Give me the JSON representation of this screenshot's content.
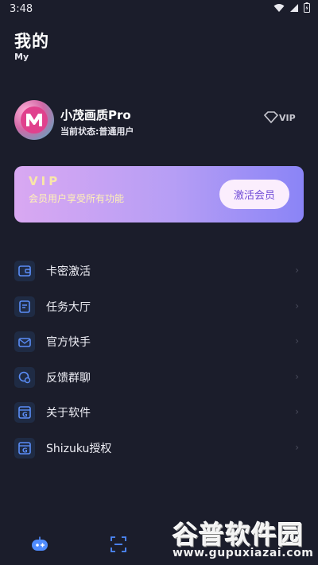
{
  "status_bar": {
    "time": "3:48"
  },
  "header": {
    "title": "我的",
    "subtitle": "My"
  },
  "profile": {
    "name": "小茂画质Pro",
    "status": "当前状态:普通用户",
    "badge_label": "VIP"
  },
  "vip_card": {
    "title": "VIP",
    "description": "会员用户享受所有功能",
    "button_label": "激活会员"
  },
  "menu": {
    "items": [
      {
        "label": "卡密激活",
        "icon": "wallet-icon"
      },
      {
        "label": "任务大厅",
        "icon": "edit-icon"
      },
      {
        "label": "官方快手",
        "icon": "mail-icon"
      },
      {
        "label": "反馈群聊",
        "icon": "chat-icon"
      },
      {
        "label": "关于软件",
        "icon": "g-app-icon"
      },
      {
        "label": "Shizuku授权",
        "icon": "g-app-icon"
      }
    ],
    "arrow": "›"
  },
  "watermark": {
    "cn": "谷普软件园",
    "url": "www.gupuxiazai.com"
  },
  "colors": {
    "accent": "#4f8cff",
    "background": "#1b1d2b",
    "vip_gradient_start": "#d9a8f2",
    "vip_gradient_end": "#8a84f6"
  }
}
